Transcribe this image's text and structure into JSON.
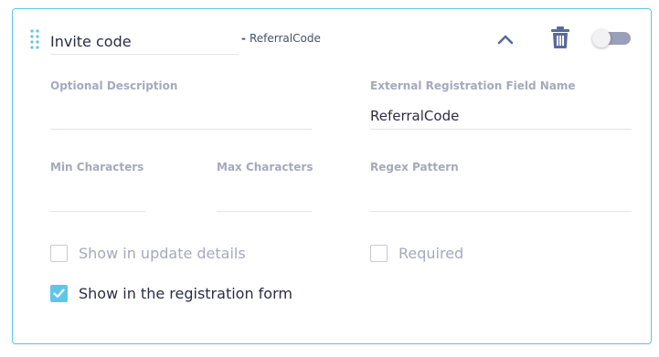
{
  "field": {
    "name_value": "Invite code",
    "key_dash": "-",
    "key": "ReferralCode"
  },
  "header_icons": {
    "drag": "drag-handle-icon",
    "collapse": "chevron-up-icon",
    "delete": "trash-icon"
  },
  "toggle": {
    "enabled": false
  },
  "form": {
    "optional_description": {
      "label": "Optional Description",
      "value": ""
    },
    "external_field_name": {
      "label": "External Registration Field Name",
      "value": "ReferralCode"
    },
    "min_characters": {
      "label": "Min Characters",
      "value": ""
    },
    "max_characters": {
      "label": "Max Characters",
      "value": ""
    },
    "regex_pattern": {
      "label": "Regex Pattern",
      "value": ""
    }
  },
  "checkboxes": {
    "show_in_update_details": {
      "label": "Show in update details",
      "checked": false
    },
    "required": {
      "label": "Required",
      "checked": false
    },
    "show_in_registration_form": {
      "label": "Show in the registration form",
      "checked": true
    }
  },
  "colors": {
    "accent": "#5fc6e6",
    "icon": "#5a6a9a",
    "muted_text": "#a5a9bd",
    "toggle_track": "#9aa0b8"
  }
}
